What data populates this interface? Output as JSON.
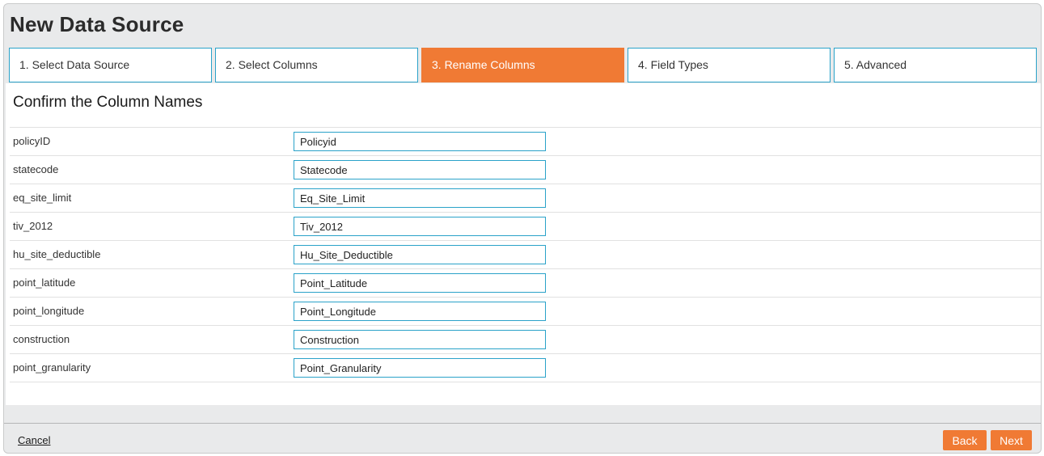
{
  "dialog": {
    "title": "New Data Source"
  },
  "wizard": {
    "steps": [
      {
        "label": "1. Select Data Source"
      },
      {
        "label": "2. Select Columns"
      },
      {
        "label": "3. Rename Columns"
      },
      {
        "label": "4. Field Types"
      },
      {
        "label": "5. Advanced"
      }
    ],
    "active_step": 3
  },
  "content": {
    "heading": "Confirm the Column Names",
    "columns": [
      {
        "source": "policyID",
        "name": "Policyid"
      },
      {
        "source": "statecode",
        "name": "Statecode"
      },
      {
        "source": "eq_site_limit",
        "name": "Eq_Site_Limit"
      },
      {
        "source": "tiv_2012",
        "name": "Tiv_2012"
      },
      {
        "source": "hu_site_deductible",
        "name": "Hu_Site_Deductible"
      },
      {
        "source": "point_latitude",
        "name": "Point_Latitude"
      },
      {
        "source": "point_longitude",
        "name": "Point_Longitude"
      },
      {
        "source": "construction",
        "name": "Construction"
      },
      {
        "source": "point_granularity",
        "name": "Point_Granularity"
      }
    ]
  },
  "footer": {
    "cancel_label": "Cancel",
    "back_label": "Back",
    "next_label": "Next"
  },
  "colors": {
    "accent": "#f07a34",
    "border": "#2aa2c9"
  }
}
